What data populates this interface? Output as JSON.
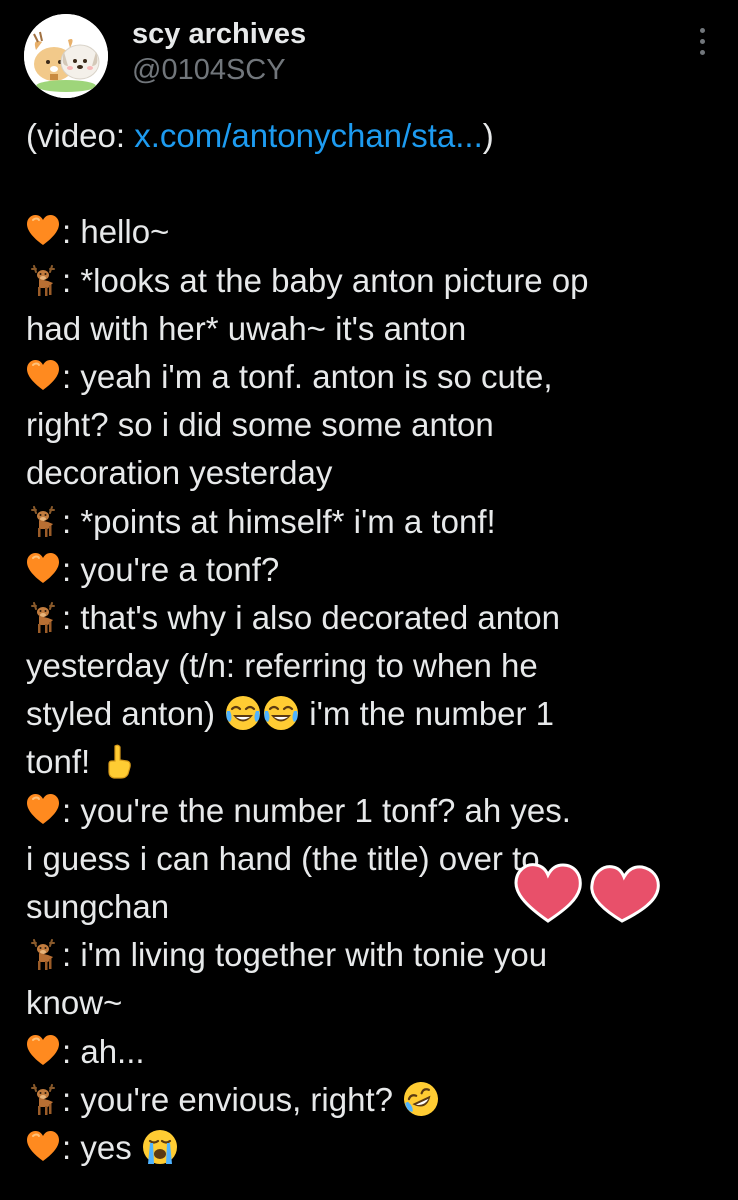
{
  "account": {
    "display_name": "scy archives",
    "handle": "@0104SCY",
    "avatar_icon": "puppy-duo-avatar"
  },
  "menu": {
    "icon": "more-vertical-icon"
  },
  "tweet": {
    "video_prefix": "(video: ",
    "video_link": "x.com/antonychan/sta...",
    "video_suffix": ")",
    "lines": {
      "l1": ": hello~",
      "l2": ": *looks at the baby anton picture op",
      "l3": "had with her* uwah~ it's anton",
      "l4": ": yeah i'm a tonf. anton is so cute,",
      "l5": "right? so i did some some anton",
      "l6": "decoration yesterday",
      "l7": ": *points at himself* i'm a tonf!",
      "l8": ": you're a tonf?",
      "l9": ": that's why i also decorated anton",
      "l10": "yesterday (t/n: referring to when he",
      "l11a": "styled anton) ",
      "l11b": " i'm the number 1",
      "l12": "tonf! ",
      "l13": ": you're the number 1 tonf? ah yes.",
      "l14": "i guess i can hand (the title) over to",
      "l15": "sungchan",
      "l16": ": i'm living together with tonie you",
      "l17": "know~",
      "l18": ": ah...",
      "l19": ": you're envious, right? ",
      "l20": ": yes "
    },
    "speaker_icons": {
      "orange": "orange-heart-icon",
      "deer": "deer-icon"
    },
    "emoji_icons": {
      "laugh": "tears-of-joy-icon",
      "point": "index-pointing-up-icon",
      "rofl": "rolling-on-floor-laughing-icon",
      "cry": "loudly-crying-icon"
    }
  },
  "colors": {
    "background": "#000000",
    "text": "#e7e9ea",
    "secondary": "#71767b",
    "link": "#1d9bf0",
    "orange_heart": "#ff8a1f",
    "pink_heart": "#e8506a"
  }
}
